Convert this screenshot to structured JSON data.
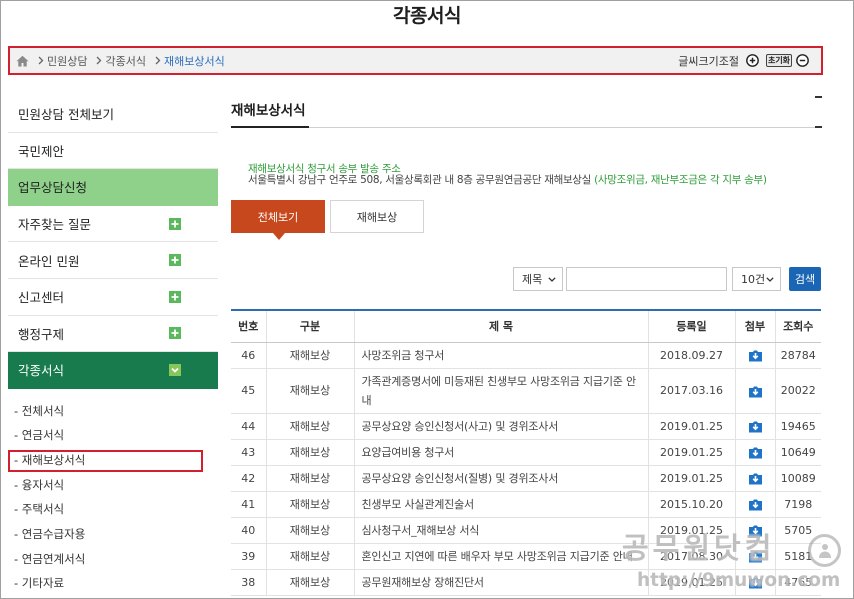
{
  "page": {
    "title": "각종서식"
  },
  "breadcrumb": {
    "home_icon": "home-icon",
    "separator_icon": "chevron-right-icon",
    "items": [
      "민원상담",
      "각종서식",
      "재해보상서식"
    ]
  },
  "font_size_control": {
    "label": "글씨크기조절",
    "increase_icon": "plus-circle-icon",
    "reset_label": "초기화",
    "decrease_icon": "minus-circle-icon"
  },
  "sidebar": {
    "items": [
      {
        "label": "민원상담 전체보기"
      },
      {
        "label": "국민제안"
      },
      {
        "label": "업무상담신청",
        "highlighted": true
      },
      {
        "label": "자주찾는 질문",
        "icon": "plus-icon"
      },
      {
        "label": "온라인 민원",
        "icon": "plus-icon"
      },
      {
        "label": "신고센터",
        "icon": "plus-icon"
      },
      {
        "label": "행정구제",
        "icon": "plus-icon"
      },
      {
        "label": "각종서식",
        "icon": "chevron-down-icon",
        "expanded": true
      }
    ],
    "submenu": [
      "- 전체서식",
      "- 연금서식",
      "- 재해보상서식",
      "- 융자서식",
      "- 주택서식",
      "- 연금수급자용",
      "- 연금연계서식",
      "- 기타자료"
    ],
    "submenu_selected_index": 2
  },
  "content": {
    "heading": "재해보상서식",
    "notice": {
      "line1": "재해보상서식 청구서 송부 발송 주소",
      "address": "서울특별시 강남구 언주로 508, 서울상록회관 내 8층 공무원연금공단 재해보상실",
      "note": "(사망조위금, 재난부조금은 각 지부 송부)"
    },
    "tabs": [
      {
        "label": "전체보기",
        "active": true
      },
      {
        "label": "재해보상",
        "active": false
      }
    ],
    "search": {
      "field_select": "제목",
      "query": "",
      "page_size_select": "10건",
      "button": "검색"
    }
  },
  "table": {
    "headers": [
      "번호",
      "구분",
      "제 목",
      "등록일",
      "첨부",
      "조회수"
    ],
    "rows": [
      {
        "num": 46,
        "category": "재해보상",
        "title": "사망조위금 청구서",
        "date": "2018.09.27",
        "attachment": "download-icon",
        "views": 28784
      },
      {
        "num": 45,
        "category": "재해보상",
        "title": "가족관계증명서에 미등재된 친생부모 사망조위금 지급기준 안내",
        "date": "2017.03.16",
        "attachment": "download-icon",
        "views": 20022
      },
      {
        "num": 44,
        "category": "재해보상",
        "title": "공무상요양 승인신청서(사고) 및 경위조사서",
        "date": "2019.01.25",
        "attachment": "download-icon",
        "views": 19465
      },
      {
        "num": 43,
        "category": "재해보상",
        "title": "요양급여비용 청구서",
        "date": "2019.01.25",
        "attachment": "download-icon",
        "views": 10649
      },
      {
        "num": 42,
        "category": "재해보상",
        "title": "공무상요양 승인신청서(질병) 및 경위조사서",
        "date": "2019.01.25",
        "attachment": "download-icon",
        "views": 10089
      },
      {
        "num": 41,
        "category": "재해보상",
        "title": "친생부모 사실관계진술서",
        "date": "2015.10.20",
        "attachment": "download-icon",
        "views": 7198
      },
      {
        "num": 40,
        "category": "재해보상",
        "title": "심사청구서_재해보상 서식",
        "date": "2019.01.25",
        "attachment": "download-icon",
        "views": 5705
      },
      {
        "num": 39,
        "category": "재해보상",
        "title": "혼인신고 지연에 따른 배우자 부모 사망조위금 지급기준 안내",
        "date": "2017.08.30",
        "attachment": "download-icon",
        "views": 5181
      },
      {
        "num": 38,
        "category": "재해보상",
        "title": "공무원재해보상 장해진단서",
        "date": "2019.01.25",
        "attachment": "download-icon",
        "views": 4765
      }
    ]
  },
  "watermark": {
    "brand": "공무원닷컴",
    "url": "http://9muwon.com"
  },
  "colors": {
    "brand_green": "#8fd18a",
    "active_green": "#187b4d",
    "plus_icon_green": "#5cb85c",
    "tab_active": "#c8481e",
    "search_button": "#1a66b5",
    "table_top_border": "#2b6cb2",
    "notice_green": "#2f9e3a",
    "breadcrumb_current": "#2b6dbf",
    "annotation_red": "#d2202f"
  }
}
